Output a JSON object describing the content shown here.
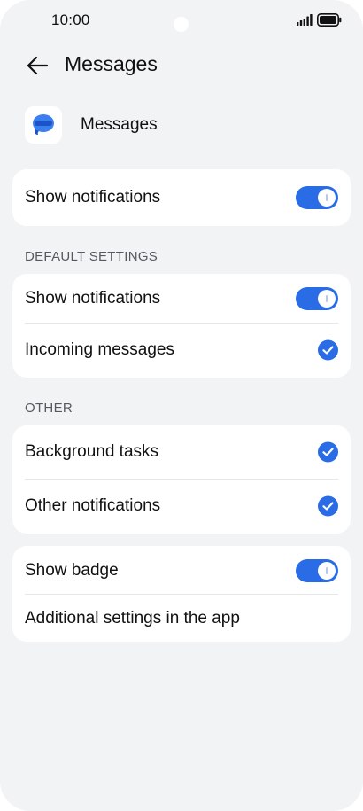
{
  "status_bar": {
    "time": "10:00"
  },
  "header": {
    "title": "Messages"
  },
  "app": {
    "name": "Messages"
  },
  "main_toggle": {
    "label": "Show notifications",
    "state": "on"
  },
  "default_settings": {
    "heading": "DEFAULT SETTINGS",
    "items": [
      {
        "label": "Show notifications",
        "control": "toggle",
        "state": "on"
      },
      {
        "label": "Incoming messages",
        "control": "checkbox",
        "state": "checked"
      }
    ]
  },
  "other": {
    "heading": "OTHER",
    "items": [
      {
        "label": "Background tasks",
        "control": "checkbox",
        "state": "checked"
      },
      {
        "label": "Other notifications",
        "control": "checkbox",
        "state": "checked"
      }
    ]
  },
  "extras": {
    "items": [
      {
        "label": "Show badge",
        "control": "toggle",
        "state": "on"
      },
      {
        "label": "Additional settings in the app"
      }
    ]
  },
  "colors": {
    "accent": "#2a6ce6",
    "background": "#f1f3f5",
    "card": "#ffffff"
  },
  "icons": [
    "back-arrow-icon",
    "signal-icon",
    "battery-icon",
    "messages-app-icon",
    "check-icon"
  ]
}
